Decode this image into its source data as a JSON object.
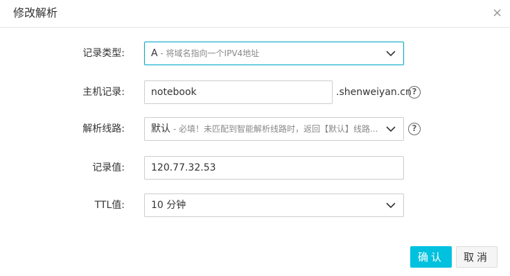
{
  "dialog": {
    "title": "修改解析",
    "close_symbol": "×"
  },
  "form": {
    "record_type": {
      "label": "记录类型:",
      "value": "A",
      "hint": " - 将域名指向一个IPV4地址"
    },
    "host_record": {
      "label": "主机记录:",
      "value": "notebook",
      "suffix": ".shenweiyan.cn"
    },
    "line": {
      "label": "解析线路:",
      "value": "默认",
      "hint": " - 必填！未匹配到智能解析线路时，返回【默认】线路..."
    },
    "record_value": {
      "label": "记录值:",
      "value": "120.77.32.53"
    },
    "ttl": {
      "label": "TTL值:",
      "value": "10 分钟"
    }
  },
  "buttons": {
    "ok_label": "确认",
    "cancel_label": "取消"
  },
  "colors": {
    "accent": "#00c1de",
    "focus_border": "#00aac7"
  },
  "icons": {
    "help": "question-circle-icon",
    "dropdown": "chevron-down-icon",
    "close": "close-icon"
  }
}
